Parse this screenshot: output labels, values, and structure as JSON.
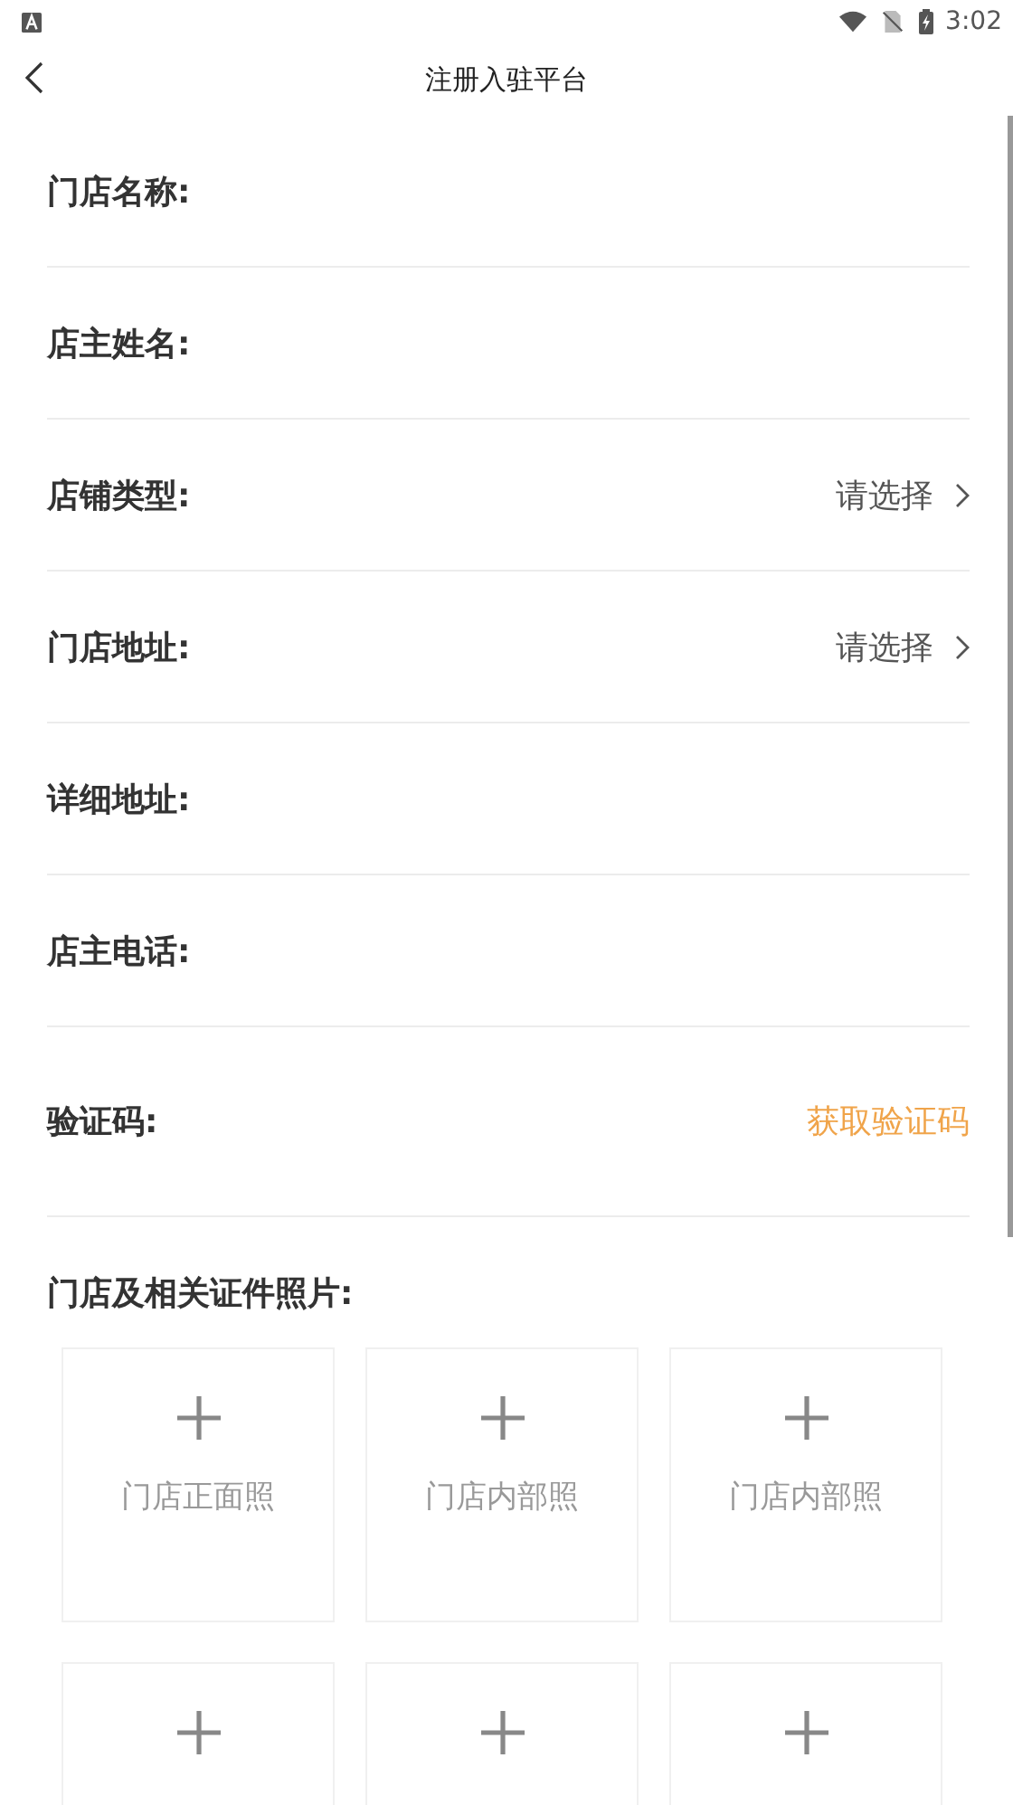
{
  "status_bar": {
    "time": "3:02"
  },
  "nav": {
    "title": "注册入驻平台"
  },
  "fields": [
    {
      "kind": "text",
      "label": "门店名称:"
    },
    {
      "kind": "text",
      "label": "店主姓名:"
    },
    {
      "kind": "select",
      "label": "店铺类型:",
      "placeholder": "请选择"
    },
    {
      "kind": "select",
      "label": "门店地址:",
      "placeholder": "请选择"
    },
    {
      "kind": "text",
      "label": "详细地址:"
    },
    {
      "kind": "text",
      "label": "店主电话:"
    },
    {
      "kind": "code",
      "label": "验证码:",
      "action": "获取验证码"
    }
  ],
  "photos": {
    "title": "门店及相关证件照片:",
    "tiles": [
      {
        "kind": "labeled",
        "label": "门店正面照"
      },
      {
        "kind": "labeled",
        "label": "门店内部照"
      },
      {
        "kind": "labeled",
        "label": "门店内部照"
      },
      {
        "kind": "plain"
      },
      {
        "kind": "plain"
      },
      {
        "kind": "plain"
      }
    ]
  }
}
